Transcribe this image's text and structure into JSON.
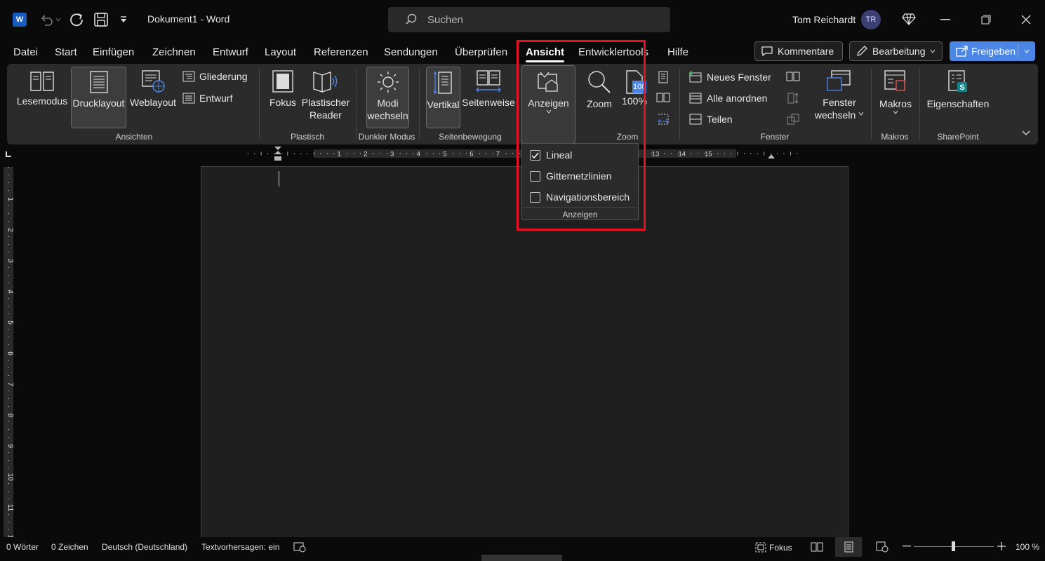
{
  "titlebar": {
    "app_icon": "word-icon",
    "app_letter": "W",
    "doc_title": "Dokument1  -  Word",
    "search_placeholder": "Suchen",
    "user_name": "Tom Reichardt",
    "user_initials": "TR"
  },
  "tabs": [
    "Datei",
    "Start",
    "Einfügen",
    "Zeichnen",
    "Entwurf",
    "Layout",
    "Referenzen",
    "Sendungen",
    "Überprüfen",
    "Ansicht",
    "Entwicklertools",
    "Hilfe"
  ],
  "active_tab": "Ansicht",
  "header_buttons": {
    "comments": "Kommentare",
    "editing": "Bearbeitung",
    "share": "Freigeben"
  },
  "ribbon": {
    "ansichten": {
      "label": "Ansichten",
      "lesemodus": "Lesemodus",
      "drucklayout": "Drucklayout",
      "weblayout": "Weblayout",
      "gliederung": "Gliederung",
      "entwurf": "Entwurf"
    },
    "plastisch": {
      "label": "Plastisch",
      "fokus": "Fokus",
      "reader_line1": "Plastischer",
      "reader_line2": "Reader"
    },
    "dunkler_modus": {
      "label": "Dunkler Modus",
      "line1": "Modi",
      "line2": "wechseln"
    },
    "seitenbewegung": {
      "label": "Seitenbewegung",
      "vertikal": "Vertikal",
      "seitenweise": "Seitenweise"
    },
    "zoom": {
      "label": "Zoom",
      "anzeigen": "Anzeigen",
      "zoom": "Zoom",
      "hundert": "100%",
      "badge": "100"
    },
    "fenster": {
      "label": "Fenster",
      "neues_fenster": "Neues Fenster",
      "alle_anordnen": "Alle anordnen",
      "teilen": "Teilen",
      "wechseln_line1": "Fenster",
      "wechseln_line2": "wechseln"
    },
    "makros": {
      "label": "Makros",
      "makros": "Makros"
    },
    "sharepoint": {
      "label": "SharePoint",
      "eigenschaften": "Eigenschaften"
    }
  },
  "ruler_numbers": [
    "1",
    "2",
    "3",
    "4",
    "5",
    "6",
    "7",
    "2",
    "13",
    "14",
    "15"
  ],
  "vruler_numbers": [
    "1",
    "2",
    "3",
    "4",
    "5",
    "6",
    "7",
    "8",
    "9",
    "10",
    "11",
    "12"
  ],
  "dropdown": {
    "items": [
      {
        "label": "Lineal",
        "checked": true
      },
      {
        "label": "Gitternetzlinien",
        "checked": false
      },
      {
        "label": "Navigationsbereich",
        "checked": false
      }
    ],
    "group_label": "Anzeigen"
  },
  "statusbar": {
    "words": "0 Wörter",
    "chars": "0 Zeichen",
    "language": "Deutsch (Deutschland)",
    "prediction": "Textvorhersagen: ein",
    "focus": "Fokus",
    "zoom": "100 %"
  },
  "colors": {
    "accent_blue": "#4b86e6",
    "highlight_red": "#e81123",
    "word_blue": "#185abd"
  }
}
